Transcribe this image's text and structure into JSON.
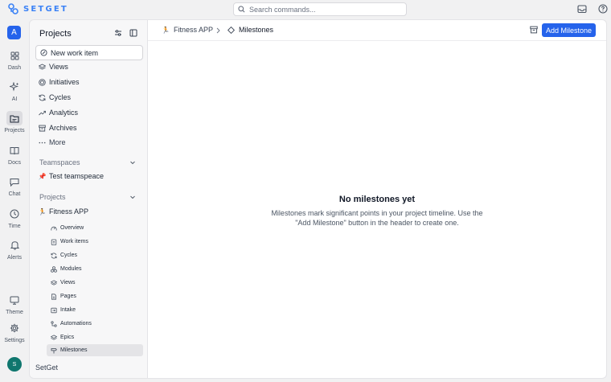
{
  "app": {
    "name": "SETGET",
    "accent": "#2563eb"
  },
  "search": {
    "placeholder": "Search commands..."
  },
  "rail": {
    "workspace_initial": "A",
    "items": [
      {
        "label": "Dash",
        "icon": "dashboard-icon"
      },
      {
        "label": "AI",
        "icon": "sparkle-icon"
      },
      {
        "label": "Projects",
        "icon": "folder-icon",
        "active": true
      },
      {
        "label": "Docs",
        "icon": "book-icon"
      },
      {
        "label": "Chat",
        "icon": "chat-icon"
      },
      {
        "label": "Time",
        "icon": "clock-icon"
      },
      {
        "label": "Alerts",
        "icon": "bell-icon"
      }
    ],
    "bottom": [
      {
        "label": "Theme",
        "icon": "monitor-icon"
      },
      {
        "label": "Settings",
        "icon": "gear-icon"
      }
    ],
    "user_initial": "S"
  },
  "sidebar": {
    "title": "Projects",
    "new_work_item": "New work item",
    "nav": [
      "Views",
      "Initiatives",
      "Cycles",
      "Analytics",
      "Archives",
      "More"
    ],
    "teamspaces_label": "Teamspaces",
    "teamspace": "Test teamspeace",
    "projects_label": "Projects",
    "project": {
      "name": "Fitness APP",
      "emoji": "🏃"
    },
    "project_items": [
      "Overview",
      "Work items",
      "Cycles",
      "Modules",
      "Views",
      "Pages",
      "Intake",
      "Automations",
      "Epics",
      "Milestones"
    ],
    "active_item": "Milestones",
    "footer": "SetGet"
  },
  "header": {
    "breadcrumb_project": "Fitness APP",
    "breadcrumb_current": "Milestones",
    "add_button": "Add Milestone"
  },
  "empty_state": {
    "title": "No milestones yet",
    "description": "Milestones mark significant points in your project timeline. Use the \"Add Milestone\" button in the header to create one."
  }
}
